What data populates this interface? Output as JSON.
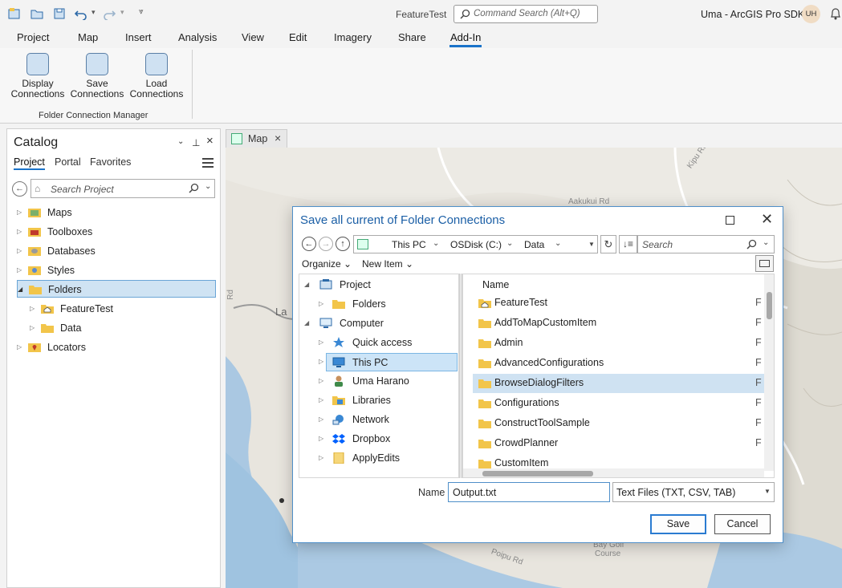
{
  "app": {
    "doc_title": "FeatureTest",
    "command_search_placeholder": "Command Search (Alt+Q)",
    "user": "Uma - ArcGIS Pro SDK",
    "avatar_initials": "UH"
  },
  "ribbon": {
    "tabs": [
      "Project",
      "Map",
      "Insert",
      "Analysis",
      "View",
      "Edit",
      "Imagery",
      "Share",
      "Add-In"
    ],
    "active_tab": "Add-In",
    "buttons": [
      {
        "line1": "Display",
        "line2": "Connections"
      },
      {
        "line1": "Save",
        "line2": "Connections"
      },
      {
        "line1": "Load",
        "line2": "Connections"
      }
    ],
    "group_label": "Folder Connection Manager"
  },
  "catalog": {
    "title": "Catalog",
    "tabs": [
      "Project",
      "Portal",
      "Favorites"
    ],
    "search_placeholder": "Search Project",
    "tree": [
      {
        "label": "Maps",
        "expanded": false
      },
      {
        "label": "Toolboxes",
        "expanded": false
      },
      {
        "label": "Databases",
        "expanded": false
      },
      {
        "label": "Styles",
        "expanded": false
      },
      {
        "label": "Folders",
        "expanded": true,
        "selected": true
      },
      {
        "label": "FeatureTest",
        "child": true
      },
      {
        "label": "Data",
        "child": true
      },
      {
        "label": "Locators",
        "expanded": false
      }
    ]
  },
  "map": {
    "tab_label": "Map",
    "labels": [
      "Aakukui Rd",
      "Kipu Rd",
      "Poipu Rd",
      "Bay Golf",
      "Course",
      "La",
      "Rd"
    ]
  },
  "dialog": {
    "title": "Save all current of Folder Connections",
    "address": [
      "This PC",
      "OSDisk (C:)",
      "Data"
    ],
    "search_placeholder": "Search",
    "organize": "Organize",
    "new_item": "New Item",
    "nav": [
      {
        "label": "Project",
        "level": 0,
        "expanded": true
      },
      {
        "label": "Folders",
        "level": 1
      },
      {
        "label": "Computer",
        "level": 0,
        "expanded": true
      },
      {
        "label": "Quick access",
        "level": 1
      },
      {
        "label": "This PC",
        "level": 1,
        "selected": true
      },
      {
        "label": "Uma Harano",
        "level": 1
      },
      {
        "label": "Libraries",
        "level": 1
      },
      {
        "label": "Network",
        "level": 1
      },
      {
        "label": "Dropbox",
        "level": 1
      },
      {
        "label": "ApplyEdits",
        "level": 1
      }
    ],
    "column_name": "Name",
    "files": [
      {
        "name": "FeatureTest"
      },
      {
        "name": "AddToMapCustomItem"
      },
      {
        "name": "Admin"
      },
      {
        "name": "AdvancedConfigurations"
      },
      {
        "name": "BrowseDialogFilters",
        "selected": true
      },
      {
        "name": "Configurations"
      },
      {
        "name": "ConstructToolSample"
      },
      {
        "name": "CrowdPlanner"
      },
      {
        "name": "CustomItem"
      }
    ],
    "name_label": "Name",
    "name_value": "Output.txt",
    "file_type": "Text Files (TXT, CSV, TAB)",
    "save_label": "Save",
    "cancel_label": "Cancel"
  },
  "colors": {
    "accent": "#1a73c9",
    "folder": "#f2c54a",
    "selection": "#cfe2f2"
  }
}
